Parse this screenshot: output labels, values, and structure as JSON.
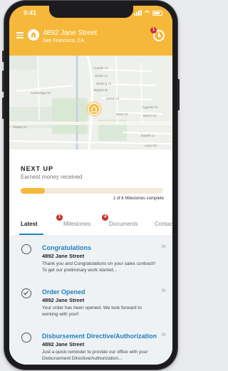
{
  "status_bar": {
    "time": "9:41"
  },
  "header": {
    "address_line1": "4892 Jane Street",
    "address_line2": "San Francisco, CA",
    "notification_count": "1"
  },
  "map": {
    "streets": [
      "Condor Ct",
      "Oriole Ct",
      "Starling Ct",
      "Skylark Dr",
      "Heron Ct",
      "Cambridge Dr",
      "Wren Ct",
      "Cygnets Ct",
      "Beech Ct",
      "Estelle Ln",
      "Moser Ct",
      "Lane Rd"
    ]
  },
  "next_up": {
    "title": "NEXT UP",
    "subtitle": "Earnest money received",
    "progress_fraction": 0.17,
    "progress_text": "1 of 6 Milestones complete"
  },
  "tabs": [
    {
      "label": "Latest",
      "badge": ""
    },
    {
      "label": "Milestones",
      "badge": "1"
    },
    {
      "label": "Documents",
      "badge": "4"
    },
    {
      "label": "Contact",
      "badge": ""
    }
  ],
  "feed": [
    {
      "title": "Congratulations",
      "subtitle": "4892 Jane Street",
      "body": "Thank you and Congratulations on your sales contract!! To get our preliminary work started...",
      "time": "3h",
      "icon": "empty-circle"
    },
    {
      "title": "Order Opened",
      "subtitle": "4892 Jane Street",
      "body": "Your order has been opened. We look forward to working with you!!",
      "time": "3h",
      "icon": "checked-circle"
    },
    {
      "title": "Disbursement Directive/Authorization",
      "subtitle": "4892 Jane Street",
      "body": "Just a quick reminder to provide our office with your Disbursement Directive/Authorization...",
      "time": "3h",
      "icon": "empty-circle"
    }
  ],
  "colors": {
    "brand": "#f6b83a",
    "link": "#1f7fc0",
    "badge": "#c9302c"
  }
}
